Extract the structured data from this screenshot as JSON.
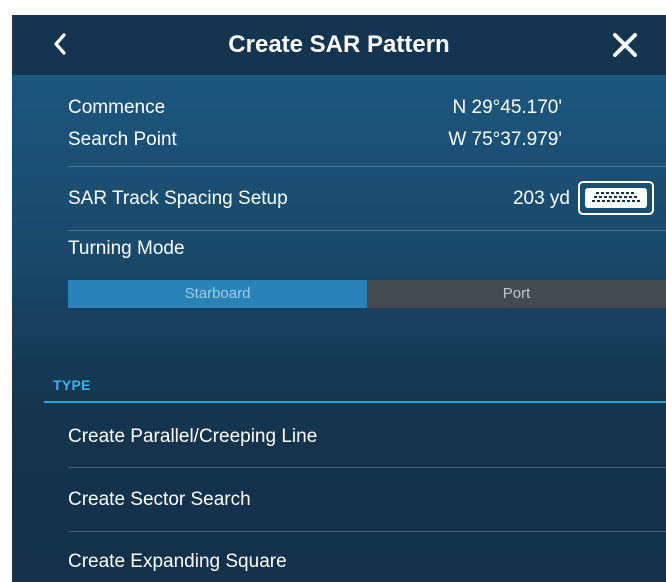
{
  "header": {
    "title": "Create SAR Pattern",
    "back_icon": "chevron-left-icon",
    "close_icon": "close-x-icon"
  },
  "commence": {
    "label_line1": "Commence",
    "label_line2": "Search Point",
    "latitude": "N 29°45.170'",
    "longitude": "W 75°37.979'"
  },
  "track_spacing": {
    "label": "SAR Track Spacing Setup",
    "value": "203 yd",
    "icon": "keyboard-icon"
  },
  "turning_mode": {
    "label": "Turning Mode",
    "options": [
      "Starboard",
      "Port"
    ],
    "selected": "Starboard"
  },
  "type_section": {
    "header": "TYPE",
    "items": [
      {
        "label": "Create Parallel/Creeping Line"
      },
      {
        "label": "Create Sector Search"
      },
      {
        "label": "Create Expanding Square"
      }
    ]
  },
  "colors": {
    "accent": "#2f9fd6",
    "selected_segment": "#2a83b8",
    "unselected_segment": "#444a50",
    "title_bar": "#143450"
  }
}
